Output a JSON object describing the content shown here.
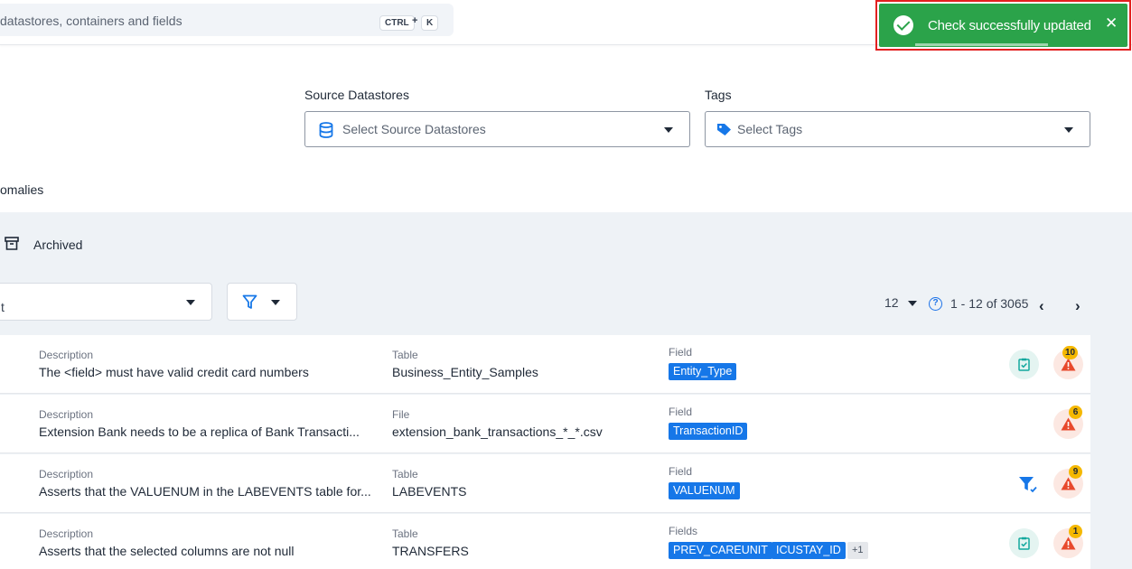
{
  "search": {
    "placeholder": "datastores, containers and fields",
    "shortcut_key1": "CTRL",
    "shortcut_plus": "+",
    "shortcut_key2": "K"
  },
  "toast": {
    "message": "Check successfully updated",
    "close": "✕",
    "color": "#2ba34a"
  },
  "filters": {
    "source_label": "Source Datastores",
    "source_placeholder": "Select Source Datastores",
    "tags_label": "Tags",
    "tags_placeholder": "Select Tags"
  },
  "tabs": {
    "anomalies_partial": "omalies",
    "archived": "Archived"
  },
  "toolbar": {
    "sort_value_partial": "t",
    "page_size": "12",
    "range": "1 - 12 of 3065",
    "prev": "‹",
    "next": "›"
  },
  "rows": [
    {
      "desc_label": "Description",
      "description": "The <field> must have valid credit card numbers",
      "source_label": "Table",
      "source": "Business_Entity_Samples",
      "field_label": "Field",
      "fields": [
        "Entity_Type"
      ],
      "more": "",
      "action": "check-icon",
      "anomaly_count": "10"
    },
    {
      "desc_label": "Description",
      "description": "Extension Bank needs to be a replica of Bank Transacti...",
      "source_label": "File",
      "source": "extension_bank_transactions_*_*.csv",
      "field_label": "Field",
      "fields": [
        "TransactionID"
      ],
      "more": "",
      "action": "",
      "anomaly_count": "6"
    },
    {
      "desc_label": "Description",
      "description": "Asserts that the VALUENUM in the LABEVENTS table for...",
      "source_label": "Table",
      "source": "LABEVENTS",
      "field_label": "Field",
      "fields": [
        "VALUENUM"
      ],
      "more": "",
      "action": "filter-check-icon",
      "anomaly_count": "9"
    },
    {
      "desc_label": "Description",
      "description": "Asserts that the selected columns are not null",
      "source_label": "Table",
      "source": "TRANSFERS",
      "field_label": "Fields",
      "fields": [
        "PREV_CAREUNIT",
        "ICUSTAY_ID"
      ],
      "more": "+1",
      "action": "check-icon",
      "anomaly_count": "1"
    }
  ]
}
